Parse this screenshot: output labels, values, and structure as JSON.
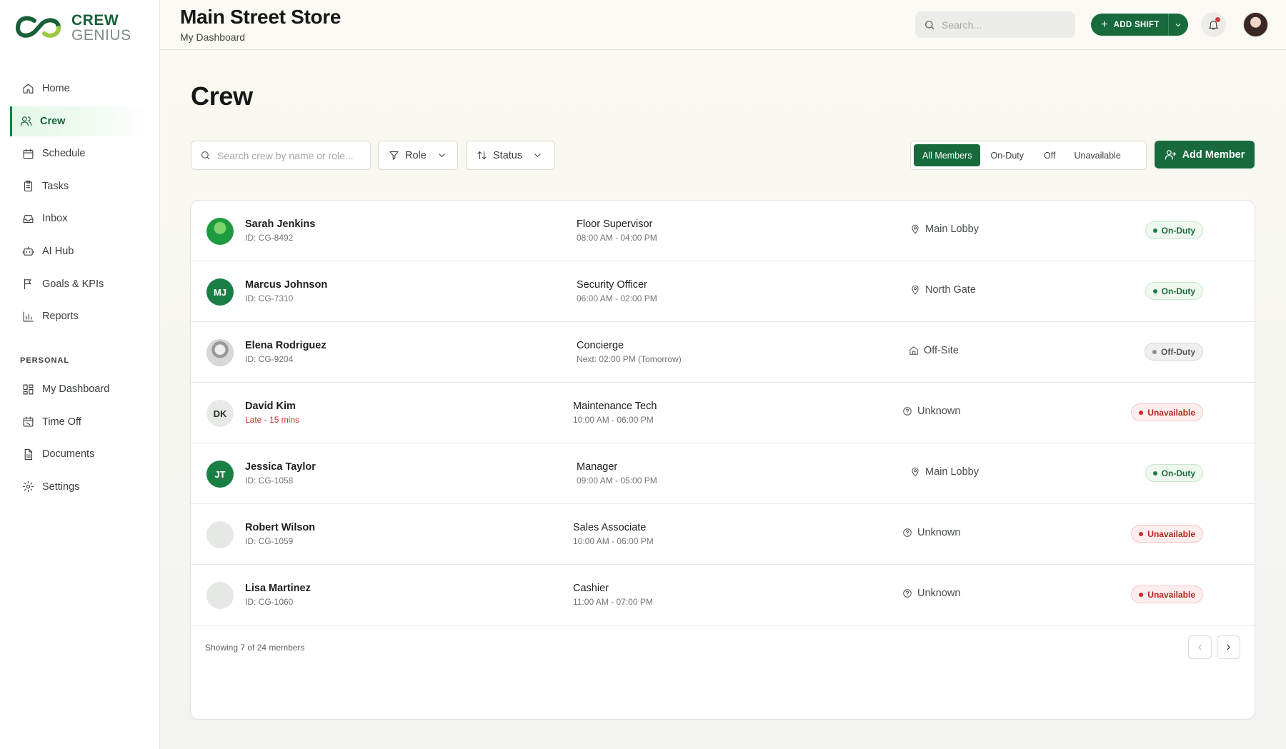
{
  "brand": {
    "line1": "CREW",
    "line2": "GENIUS",
    "primary": "#17603a",
    "accent": "#9bc93c"
  },
  "sidebar": {
    "items": [
      {
        "label": "Home",
        "icon": "home-icon",
        "active": false
      },
      {
        "label": "Crew",
        "icon": "users-icon",
        "active": true
      },
      {
        "label": "Schedule",
        "icon": "calendar-icon",
        "active": false
      },
      {
        "label": "Tasks",
        "icon": "clipboard-icon",
        "active": false
      },
      {
        "label": "Inbox",
        "icon": "inbox-icon",
        "active": false
      },
      {
        "label": "AI Hub",
        "icon": "robot-icon",
        "active": false
      },
      {
        "label": "Goals & KPIs",
        "icon": "flag-icon",
        "active": false
      },
      {
        "label": "Reports",
        "icon": "bar-chart-icon",
        "active": false
      }
    ],
    "section_label": "PERSONAL",
    "personal": [
      {
        "label": "My Dashboard",
        "icon": "grid-icon"
      },
      {
        "label": "Time Off",
        "icon": "calendar-off-icon"
      },
      {
        "label": "Documents",
        "icon": "document-icon"
      },
      {
        "label": "Settings",
        "icon": "gear-icon"
      }
    ]
  },
  "header": {
    "title": "Main Street Store",
    "subtitle": "My Dashboard",
    "search_placeholder": "Search...",
    "add_shift_label": "ADD SHIFT"
  },
  "page": {
    "title": "Crew",
    "search_placeholder": "Search crew by name or role...",
    "role_filter": "Role",
    "status_filter": "Status",
    "segments": [
      "All Members",
      "On-Duty",
      "Off",
      "Unavailable"
    ],
    "active_segment": "All Members",
    "add_member_label": "Add Member"
  },
  "crew": [
    {
      "name": "Sarah Jenkins",
      "sub": "ID: CG-8492",
      "role": "Floor Supervisor",
      "time": "08:00 AM - 04:00 PM",
      "location": "Main Lobby",
      "location_icon": "map-pin-icon",
      "status": "On-Duty",
      "avatar": "photo-green",
      "initials": ""
    },
    {
      "name": "Marcus Johnson",
      "sub": "ID: CG-7310",
      "role": "Security Officer",
      "time": "06:00 AM - 02:00 PM",
      "location": "North Gate",
      "location_icon": "map-pin-icon",
      "status": "On-Duty",
      "avatar": "green",
      "initials": "MJ"
    },
    {
      "name": "Elena Rodriguez",
      "sub": "ID: CG-9204",
      "role": "Concierge",
      "time": "Next: 02:00 PM (Tomorrow)",
      "location": "Off-Site",
      "location_icon": "house-icon",
      "status": "Off-Duty",
      "avatar": "photo-grey",
      "initials": ""
    },
    {
      "name": "David Kim",
      "sub": "Late - 15 mins",
      "role": "Maintenance Tech",
      "time": "10:00 AM - 06:00 PM",
      "location": "Unknown",
      "location_icon": "question-circle-icon",
      "status": "Unavailable",
      "avatar": "grey",
      "initials": "DK"
    },
    {
      "name": "Jessica Taylor",
      "sub": "ID: CG-1058",
      "role": "Manager",
      "time": "09:00 AM - 05:00 PM",
      "location": "Main Lobby",
      "location_icon": "map-pin-icon",
      "status": "On-Duty",
      "avatar": "green",
      "initials": "JT"
    },
    {
      "name": "Robert Wilson",
      "sub": "ID: CG-1059",
      "role": "Sales Associate",
      "time": "10:00 AM - 06:00 PM",
      "location": "Unknown",
      "location_icon": "question-circle-icon",
      "status": "Unavailable",
      "avatar": "plain",
      "initials": ""
    },
    {
      "name": "Lisa Martinez",
      "sub": "ID: CG-1060",
      "role": "Cashier",
      "time": "11:00 AM - 07:00 PM",
      "location": "Unknown",
      "location_icon": "question-circle-icon",
      "status": "Unavailable",
      "avatar": "plain",
      "initials": ""
    }
  ],
  "footer": {
    "showing": "Showing 7 of 24 members"
  },
  "colors": {
    "on_duty": "#1a7f45",
    "off_duty": "#8a8f8c",
    "unavailable": "#c82a2a"
  }
}
